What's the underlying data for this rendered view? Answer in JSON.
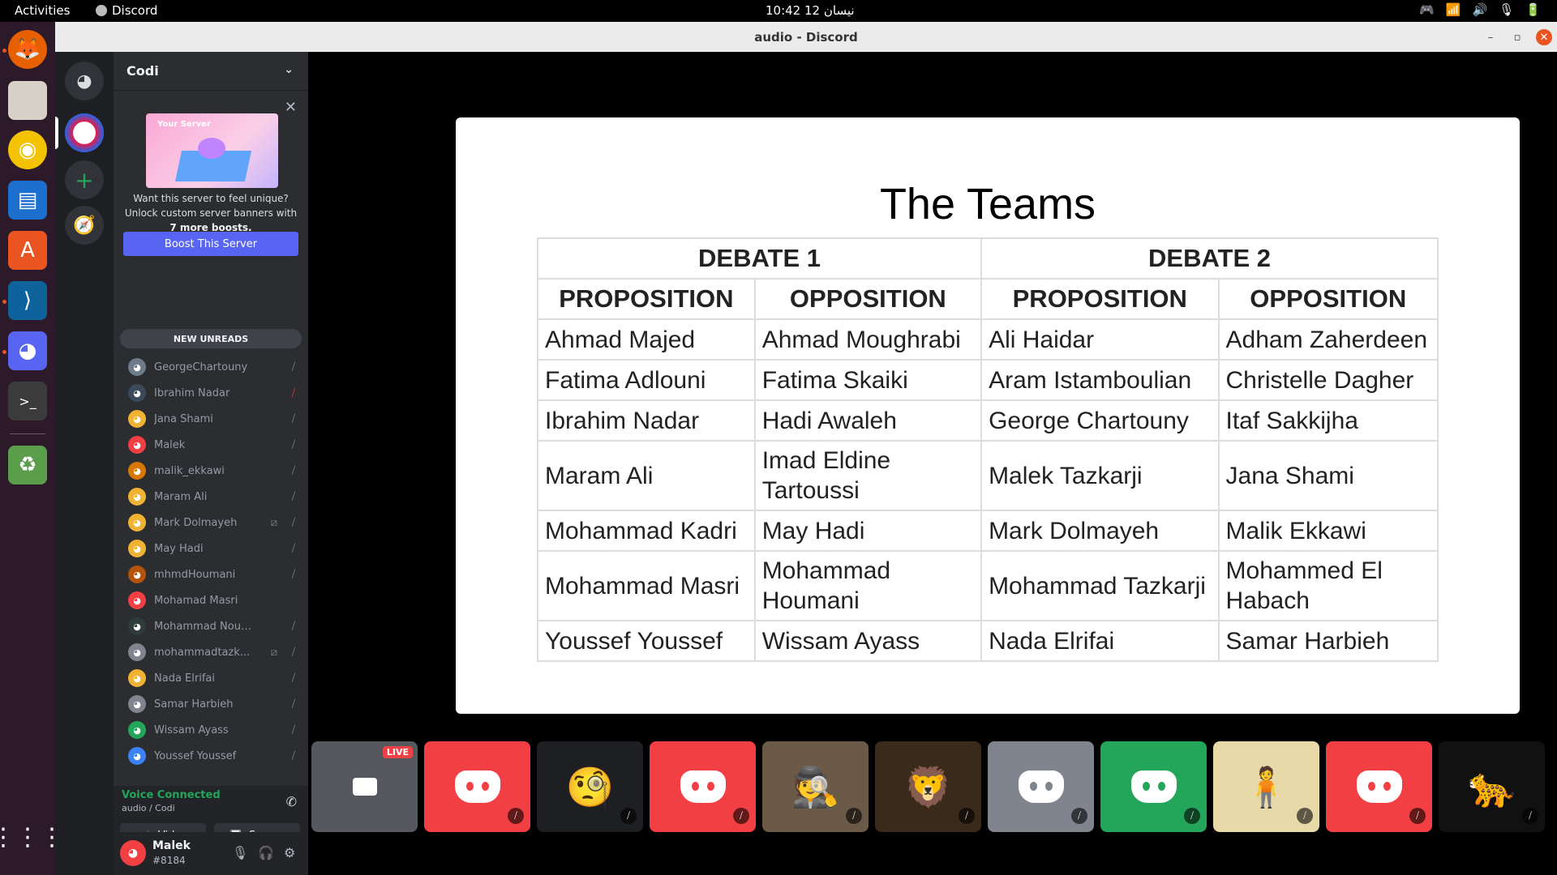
{
  "topbar": {
    "activities": "Activities",
    "app_name": "Discord",
    "clock": "10:42  12 نيسان",
    "tray": [
      "🎮",
      "📶",
      "🔊",
      "🎙",
      "🔋"
    ]
  },
  "window": {
    "title": "audio - Discord",
    "minimize": "–",
    "maximize": "▫",
    "close": "✕"
  },
  "server": {
    "name": "Codi"
  },
  "boost": {
    "banner_label": "Your Server",
    "text_line1": "Want this server to feel unique?",
    "text_line2": "Unlock custom server banners with",
    "text_bold": "7 more boosts.",
    "button": "Boost This Server"
  },
  "new_unreads": "NEW UNREADS",
  "members": [
    {
      "name": "GeorgeChartouny",
      "color": "#6d7b8a",
      "mic": "muted"
    },
    {
      "name": "Ibrahim Nadar",
      "color": "#3b4a5a",
      "mic": "red"
    },
    {
      "name": "Jana Shami",
      "color": "#f0b232",
      "mic": "muted"
    },
    {
      "name": "Malek",
      "color": "#f23f43",
      "mic": "muted"
    },
    {
      "name": "malik_ekkawi",
      "color": "#d97706",
      "mic": "muted"
    },
    {
      "name": "Maram Ali",
      "color": "#f0b232",
      "mic": "muted"
    },
    {
      "name": "Mark Dolmayeh",
      "color": "#f0b232",
      "mic": "muted",
      "video": true
    },
    {
      "name": "May Hadi",
      "color": "#f0b232",
      "mic": "muted"
    },
    {
      "name": "mhmdHoumani",
      "color": "#b45309",
      "mic": "muted"
    },
    {
      "name": "Mohamad Masri",
      "color": "#f23f43",
      "mic": "none"
    },
    {
      "name": "Mohammad Nour K...",
      "color": "#2f3d3a",
      "mic": "muted"
    },
    {
      "name": "mohammadtazk...",
      "color": "#80848e",
      "mic": "muted",
      "video": true
    },
    {
      "name": "Nada Elrifai",
      "color": "#f0b232",
      "mic": "muted"
    },
    {
      "name": "Samar Harbieh",
      "color": "#80848e",
      "mic": "muted"
    },
    {
      "name": "Wissam Ayass",
      "color": "#23a55a",
      "mic": "muted"
    },
    {
      "name": "Youssef Youssef",
      "color": "#3b82f6",
      "mic": "muted"
    }
  ],
  "voice": {
    "status": "Voice Connected",
    "channel": "audio / Codi",
    "video_btn": "Video",
    "screen_btn": "Screen"
  },
  "user": {
    "name": "Malek",
    "tag": "#8184"
  },
  "slide": {
    "title": "The Teams",
    "debate1": "DEBATE 1",
    "debate2": "DEBATE 2",
    "headers": [
      "PROPOSITION",
      "OPPOSITION",
      "PROPOSITION",
      "OPPOSITION"
    ],
    "rows": [
      [
        "Ahmad Majed",
        "Ahmad Moughrabi",
        "Ali Haidar",
        "Adham Zaherdeen"
      ],
      [
        "Fatima Adlouni",
        "Fatima Skaiki",
        "Aram Istamboulian",
        "Christelle Dagher"
      ],
      [
        "Ibrahim Nadar",
        "Hadi Awaleh",
        "George Chartouny",
        "Itaf Sakkijha"
      ],
      [
        "Maram Ali",
        "Imad Eldine Tartoussi",
        "Malek Tazkarji",
        "Jana Shami"
      ],
      [
        "Mohammad Kadri",
        "May Hadi",
        "Mark Dolmayeh",
        "Malik Ekkawi"
      ],
      [
        "Mohammad Masri",
        "Mohammad Houmani",
        "Mohammad Tazkarji",
        "Mohammed El Habach"
      ],
      [
        "Youssef Youssef",
        "Wissam Ayass",
        "Nada Elrifai",
        "Samar Harbieh"
      ]
    ]
  },
  "tiles": {
    "live_label": "LIVE",
    "items": [
      {
        "kind": "live",
        "bg": "#55595e"
      },
      {
        "kind": "discord",
        "bg": "#f23f43"
      },
      {
        "kind": "emoji",
        "bg": "#1e1f22",
        "glyph": "🧐"
      },
      {
        "kind": "discord",
        "bg": "#f23f43"
      },
      {
        "kind": "photo",
        "bg": "#6b5a48",
        "glyph": "🕵"
      },
      {
        "kind": "photo",
        "bg": "#3a2a1a",
        "glyph": "🦁"
      },
      {
        "kind": "discord",
        "bg": "#80848e"
      },
      {
        "kind": "discord",
        "bg": "#23a55a"
      },
      {
        "kind": "photo",
        "bg": "#e8d9a8",
        "glyph": "🧍"
      },
      {
        "kind": "discord",
        "bg": "#f23f43"
      },
      {
        "kind": "photo",
        "bg": "#111",
        "glyph": "🐆"
      }
    ]
  }
}
